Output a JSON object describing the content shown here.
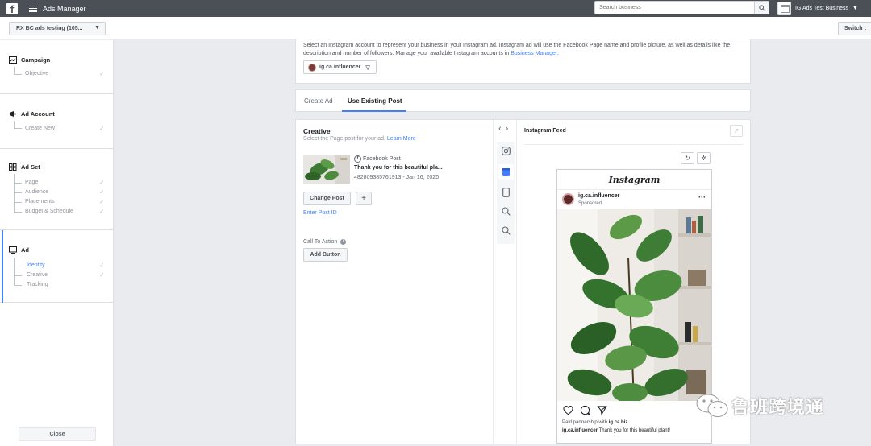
{
  "topbar": {
    "app_title": "Ads Manager",
    "search_placeholder": "Search business",
    "business_name": "IG Ads Test Business"
  },
  "subbar": {
    "campaign_select": "RX BC ads testing (105...",
    "switch_button": "Switch t"
  },
  "sidebar": {
    "campaign": {
      "title": "Campaign",
      "items": [
        "Objective"
      ]
    },
    "ad_account": {
      "title": "Ad Account",
      "items": [
        "Create New"
      ]
    },
    "ad_set": {
      "title": "Ad Set",
      "items": [
        "Page",
        "Audience",
        "Placements",
        "Budget & Schedule"
      ]
    },
    "ad": {
      "title": "Ad",
      "items": [
        "Identity",
        "Creative",
        "Tracking"
      ],
      "active": "Identity"
    },
    "close_button": "Close"
  },
  "identity": {
    "description": "Select an Instagram account to represent your business in your Instagram ad. Instagram ad will use the Facebook Page name and profile picture, as well as details like the description and number of followers. Manage your available Instagram accounts in",
    "link": "Business Manager",
    "link_suffix": ".",
    "account": "ig.ca.influencer"
  },
  "tabs": [
    "Create Ad",
    "Use Existing Post"
  ],
  "creative": {
    "title": "Creative",
    "subtitle": "Select the Page post for your ad.",
    "learn_more": "Learn More",
    "post_type": "Facebook Post",
    "post_text": "Thank you for this beautiful pla...",
    "post_meta": "482809385761913 - Jan 16, 2020",
    "change_post": "Change Post",
    "add": "+",
    "enter_post_id": "Enter Post ID",
    "cta_label": "Call To Action",
    "add_button": "Add Button"
  },
  "preview": {
    "title": "Instagram Feed",
    "ig_logo": "Instagram",
    "username": "ig.ca.influencer",
    "sponsored": "Sponsored",
    "partnership_prefix": "Paid partnership with",
    "partner": "ig.ca.biz",
    "caption_user": "ig.ca.influencer",
    "caption_text": "Thank you for this beautiful plant!"
  },
  "watermark": {
    "text": "鲁班跨境通"
  },
  "colors": {
    "topbar": "#4b4f56",
    "accent": "#4080ff",
    "background": "#e9ebee"
  }
}
